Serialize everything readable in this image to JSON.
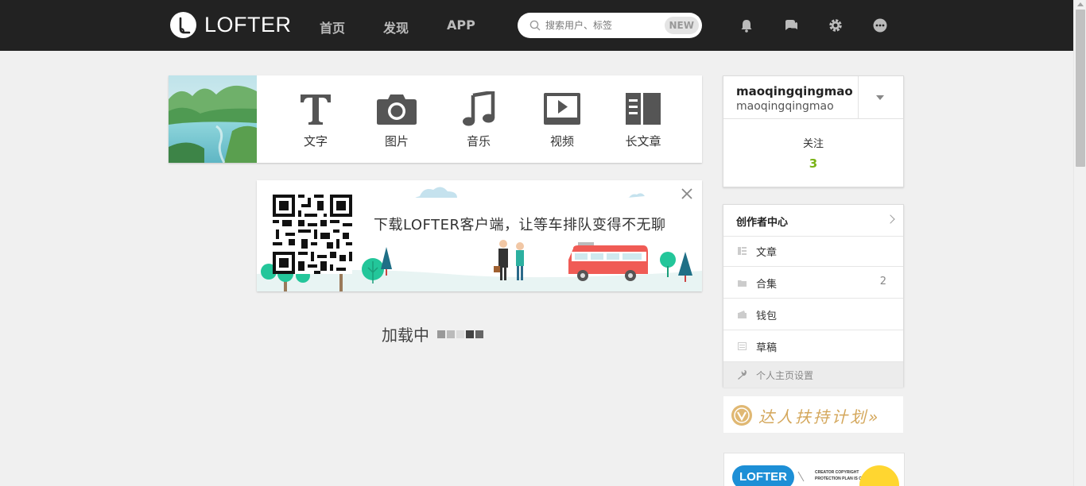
{
  "brand": {
    "name": "LOFTER"
  },
  "nav": [
    {
      "label": "首页"
    },
    {
      "label": "发现"
    },
    {
      "label": "APP"
    }
  ],
  "search": {
    "placeholder": "搜索用户、标签",
    "badge": "NEW"
  },
  "header_icons": [
    "bell-icon",
    "chat-icon",
    "gear-icon",
    "more-icon"
  ],
  "publish": {
    "items": [
      {
        "label": "文字",
        "icon": "text-icon"
      },
      {
        "label": "图片",
        "icon": "camera-icon"
      },
      {
        "label": "音乐",
        "icon": "music-icon"
      },
      {
        "label": "视频",
        "icon": "video-icon"
      },
      {
        "label": "长文章",
        "icon": "article-icon"
      }
    ]
  },
  "banner": {
    "text": "下载LOFTER客户端，让等车排队变得不无聊"
  },
  "loading": {
    "text": "加载中"
  },
  "profile": {
    "name": "maoqingqingmao",
    "id": "maoqingqingmao",
    "follow_label": "关注",
    "follow_count": "3"
  },
  "menu": {
    "title": "创作者中心",
    "items": [
      {
        "label": "文章",
        "count": ""
      },
      {
        "label": "合集",
        "count": "2"
      },
      {
        "label": "钱包",
        "count": ""
      },
      {
        "label": "草稿",
        "count": ""
      }
    ],
    "settings": "个人主页设置"
  },
  "daren": {
    "text": "达人扶持计划»"
  },
  "promo": {
    "label": "LOFTER",
    "small_line1": "CREATOR COPYRIGHT",
    "small_line2": "PROTECTION PLAN IS ONLINE"
  },
  "colors": {
    "topbar": "#222222",
    "accent_green": "#7ab317",
    "gold": "#d4a75b",
    "blue": "#1d8fd6"
  }
}
